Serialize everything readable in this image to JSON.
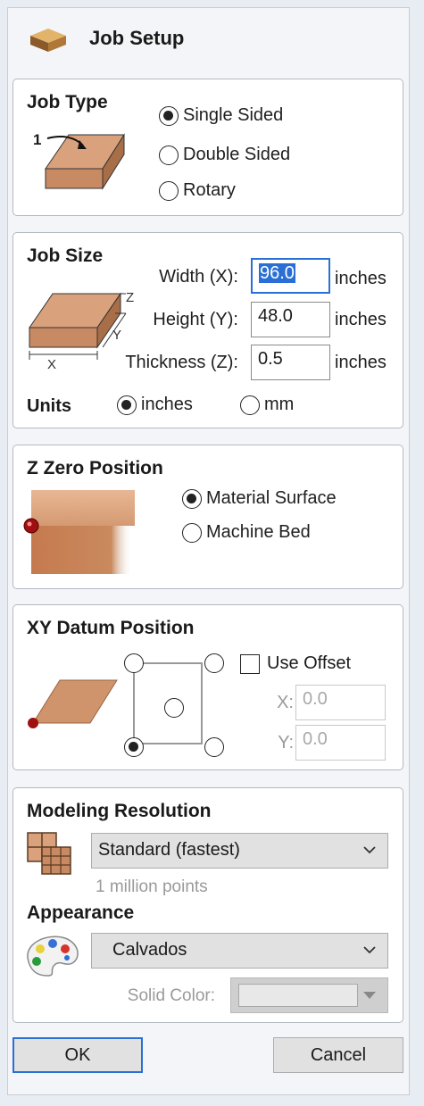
{
  "header": {
    "title": "Job Setup",
    "icon": "material-block-icon"
  },
  "job_type": {
    "title": "Job Type",
    "side_number": "1",
    "options": [
      "Single Sided",
      "Double Sided",
      "Rotary"
    ],
    "selected": "Single Sided"
  },
  "job_size": {
    "title": "Job Size",
    "width_label": "Width (X):",
    "width_value": "96.0",
    "height_label": "Height (Y):",
    "height_value": "48.0",
    "thickness_label": "Thickness (Z):",
    "thickness_value": "0.5",
    "unit": "inches",
    "axis_x": "X",
    "axis_y": "Y",
    "axis_z": "Z",
    "units_label": "Units",
    "unit_options": [
      "inches",
      "mm"
    ],
    "selected_unit": "inches"
  },
  "z_zero": {
    "title": "Z Zero Position",
    "options": [
      "Material Surface",
      "Machine Bed"
    ],
    "selected": "Material Surface"
  },
  "xy_datum": {
    "title": "XY Datum Position",
    "use_offset_label": "Use Offset",
    "use_offset_checked": false,
    "x_label": "X:",
    "x_value": "0.0",
    "y_label": "Y:",
    "y_value": "0.0",
    "selected_point": "bottom-left"
  },
  "modeling": {
    "title": "Modeling Resolution",
    "resolution": "Standard (fastest)",
    "points_note": "1 million points"
  },
  "appearance": {
    "title": "Appearance",
    "material": "Calvados",
    "solid_color_label": "Solid Color:"
  },
  "buttons": {
    "ok": "OK",
    "cancel": "Cancel"
  },
  "colors": {
    "accent": "#2a6fd6",
    "wood_top": "#d9a27c",
    "wood_side": "#b87a52",
    "datum_dot": "#a01010"
  }
}
